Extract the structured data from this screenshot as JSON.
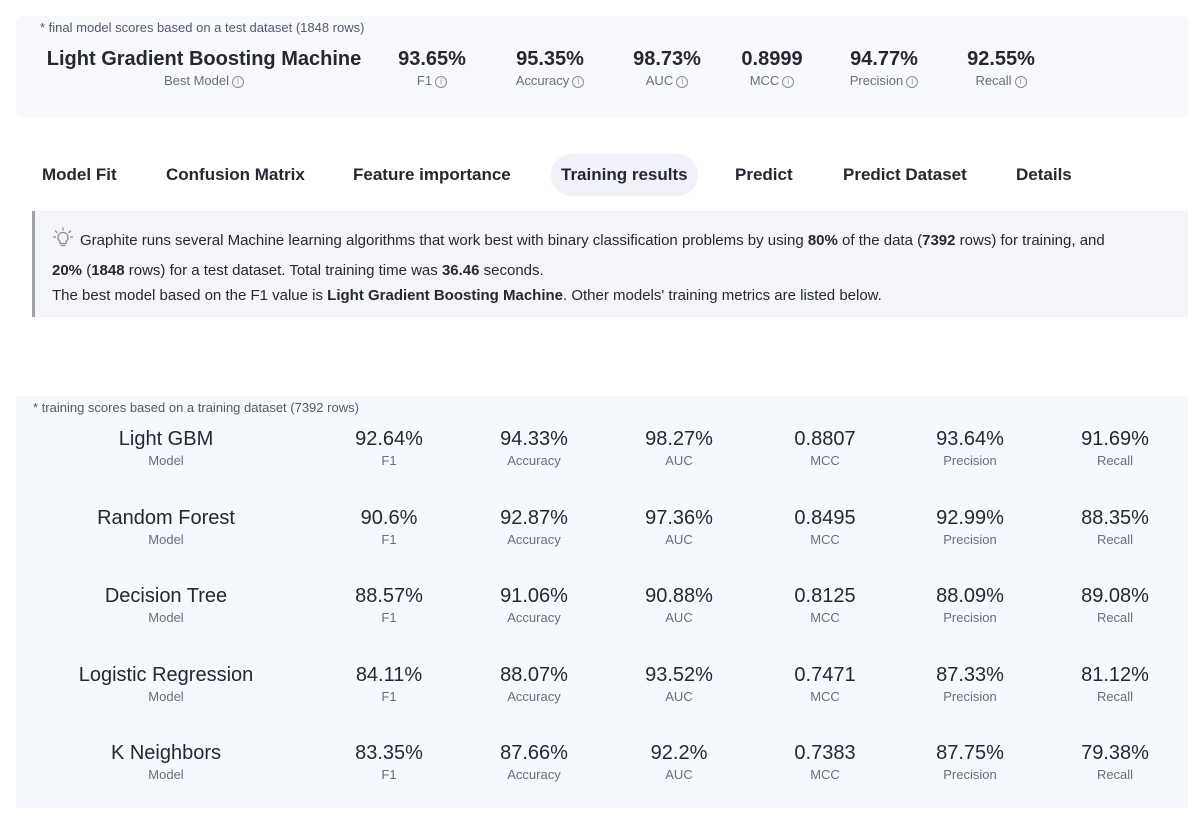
{
  "summary": {
    "note": "* final model scores based on a test dataset (1848 rows)",
    "best_model": {
      "value": "Light Gradient Boosting Machine",
      "label": "Best Model"
    },
    "metrics": [
      {
        "value": "93.65%",
        "label": "F1"
      },
      {
        "value": "95.35%",
        "label": "Accuracy"
      },
      {
        "value": "98.73%",
        "label": "AUC"
      },
      {
        "value": "0.8999",
        "label": "MCC"
      },
      {
        "value": "94.77%",
        "label": "Precision"
      },
      {
        "value": "92.55%",
        "label": "Recall"
      }
    ],
    "info_icon_glyph": "i"
  },
  "tabs": [
    {
      "label": "Model Fit",
      "active": false
    },
    {
      "label": "Confusion Matrix",
      "active": false
    },
    {
      "label": "Feature importance",
      "active": false
    },
    {
      "label": "Training results",
      "active": true
    },
    {
      "label": "Predict",
      "active": false
    },
    {
      "label": "Predict Dataset",
      "active": false
    },
    {
      "label": "Details",
      "active": false
    }
  ],
  "info": {
    "icon": "lightbulb-icon",
    "t1": "Graphite runs several Machine learning algorithms that work best with binary classification problems by using ",
    "b1": "80%",
    "t2": " of the data (",
    "b2": "7392",
    "t3": " rows) for training, and",
    "b3": "20%",
    "t4": " (",
    "b4": "1848",
    "t5": " rows) for a test dataset. Total training time was ",
    "b5": "36.46",
    "t6": " seconds.",
    "t7": "The best model based on the F1 value is ",
    "b6": "Light Gradient Boosting Machine",
    "t8": ". Other models' training metrics are listed below."
  },
  "training": {
    "note": "* training scores based on a training dataset (7392 rows)",
    "labels": [
      "Model",
      "F1",
      "Accuracy",
      "AUC",
      "MCC",
      "Precision",
      "Recall"
    ],
    "rows": [
      [
        "Light GBM",
        "92.64%",
        "94.33%",
        "98.27%",
        "0.8807",
        "93.64%",
        "91.69%"
      ],
      [
        "Random Forest",
        "90.6%",
        "92.87%",
        "97.36%",
        "0.8495",
        "92.99%",
        "88.35%"
      ],
      [
        "Decision Tree",
        "88.57%",
        "91.06%",
        "90.88%",
        "0.8125",
        "88.09%",
        "89.08%"
      ],
      [
        "Logistic Regression",
        "84.11%",
        "88.07%",
        "93.52%",
        "0.7471",
        "87.33%",
        "81.12%"
      ],
      [
        "K Neighbors",
        "83.35%",
        "87.66%",
        "92.2%",
        "0.7383",
        "87.75%",
        "79.38%"
      ]
    ]
  }
}
